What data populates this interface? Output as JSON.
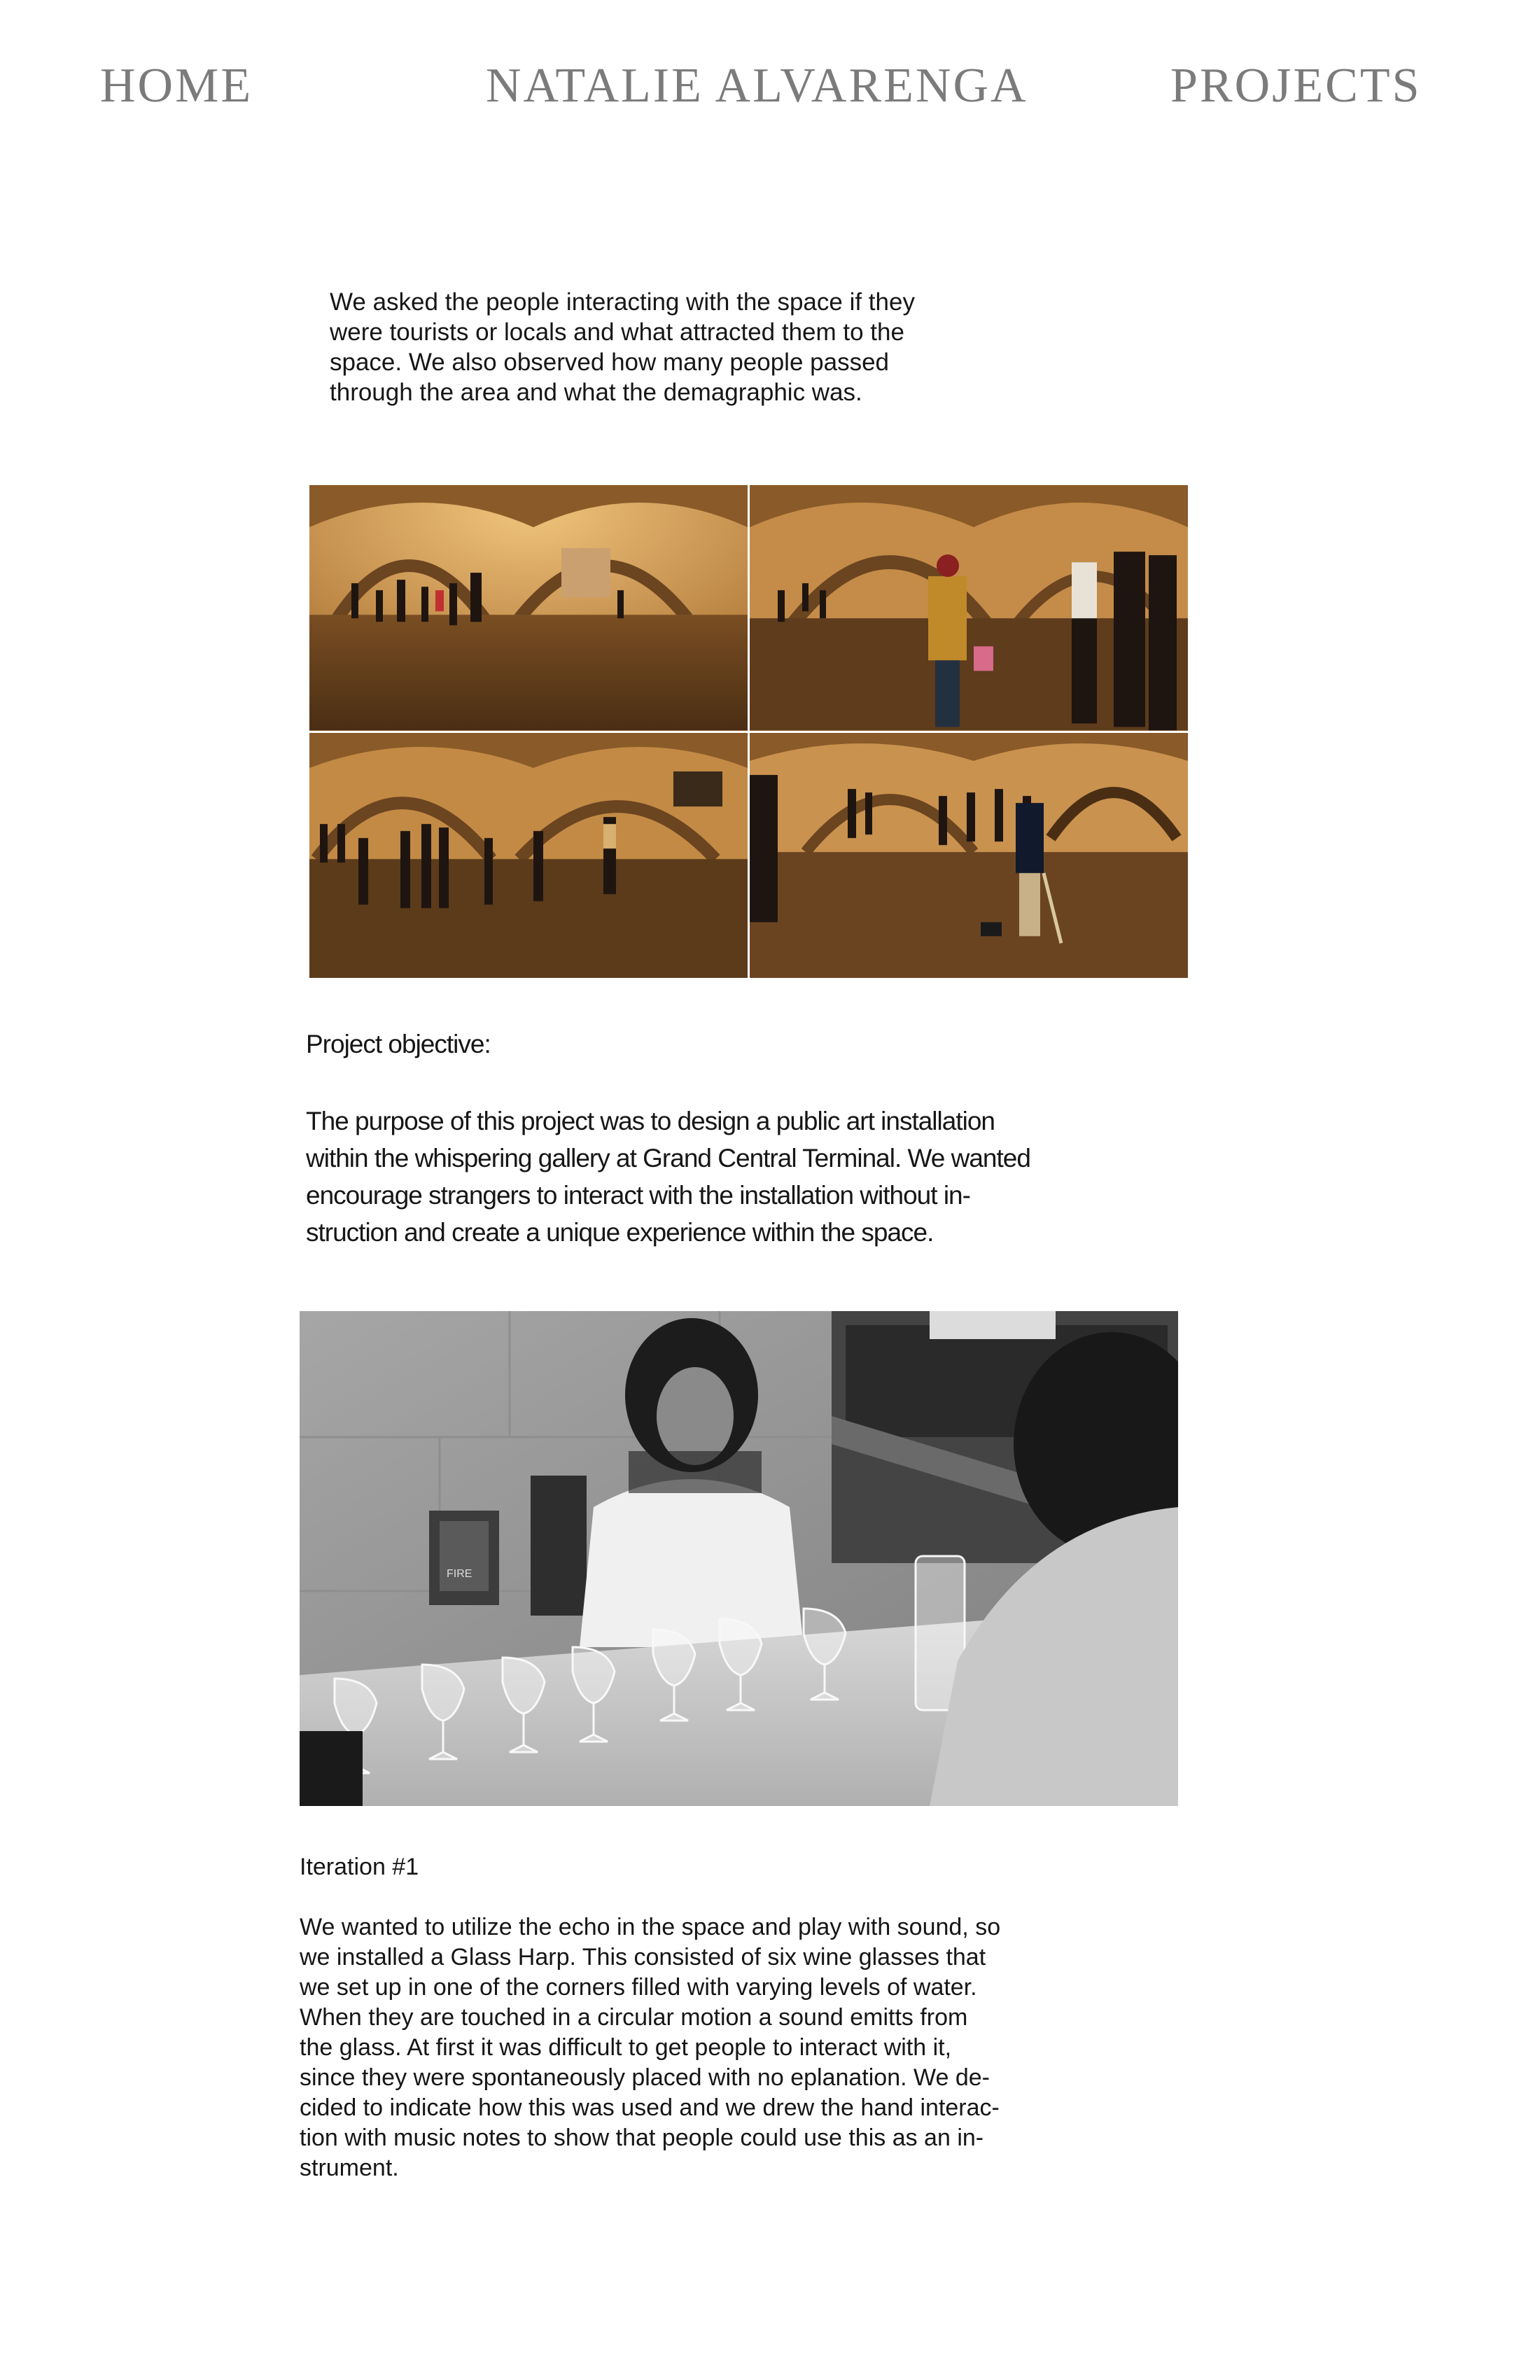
{
  "nav": {
    "home": "HOME",
    "site_title": "NATALIE ALVARENGA",
    "projects": "PROJECTS"
  },
  "intro": {
    "text": "We asked the people interacting with the space if they\nwere tourists or locals and what attracted them to the\nspace. We also observed how many people passed\nthrough the area and what the demagraphic was."
  },
  "objective": {
    "heading": "Project objective:",
    "text": "The purpose of this project was to design a public art installation\nwithin the whispering gallery at Grand Central Terminal. We wanted\nencourage strangers to interact with the installation without in-\nstruction and create a unique experience within the space."
  },
  "iteration": {
    "heading": "Iteration #1",
    "text": "We wanted to utilize the echo in the space and play with sound, so\nwe installed a Glass Harp. This consisted of six wine glasses  that\nwe set up in one of the corners filled with varying levels of water.\nWhen they are touched in a circular motion a sound emitts from\nthe glass. At first it was difficult to get people to interact with it,\nsince they were spontaneously placed with no eplanation. We de-\ncided to indicate how this was used and we drew the hand interac-\ntion with music notes to show that people could use this as an in-\nstrument."
  },
  "photos": {
    "gallery_tiles": [
      {
        "subject": "whispering-gallery-crowd-photo"
      },
      {
        "subject": "whispering-gallery-travelers-photo"
      },
      {
        "subject": "whispering-gallery-walkers-photo"
      },
      {
        "subject": "whispering-gallery-cleaner-photo"
      }
    ],
    "glass_harp": {
      "subject": "glass-harp-photo",
      "sign_text": "FIRE"
    }
  },
  "colors": {
    "nav": "#7b7b7b",
    "text": "#161616",
    "warm_photo_base": "#b7803f"
  }
}
